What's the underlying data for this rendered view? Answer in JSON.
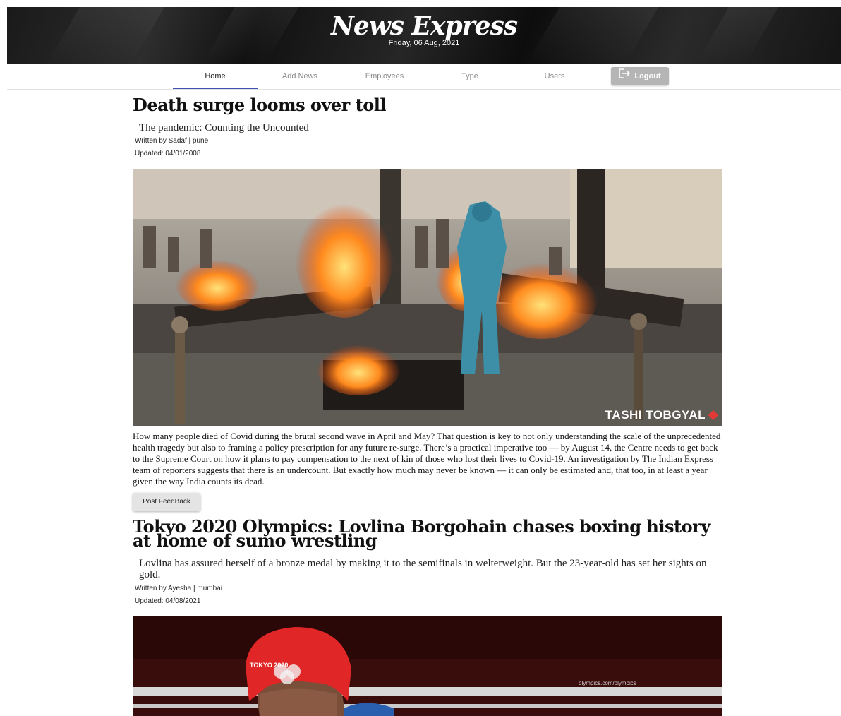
{
  "brand": {
    "title": "News Express",
    "date": "Friday, 06 Aug, 2021"
  },
  "nav": {
    "tabs": [
      {
        "label": "Home"
      },
      {
        "label": "Add News"
      },
      {
        "label": "Employees"
      },
      {
        "label": "Type"
      },
      {
        "label": "Users"
      }
    ],
    "active_tab": "Home",
    "logout_label": "Logout"
  },
  "articles": [
    {
      "headline": "Death surge looms over toll",
      "subhead": "The pandemic: Counting the Uncounted",
      "byline": "Written by Sadaf | pune",
      "updated": "Updated: 04/01/2008",
      "image_credit": "TASHI TOBGYAL",
      "body": "How many people died of Covid during the brutal second wave in April and May? That question is key to not only understanding the scale of the unprecedented health tragedy but also to framing a policy prescription for any future re-surge. There’s a practical imperative too — by August 14, the Centre needs to get back to the Supreme Court on how it plans to pay compensation to the next of kin of those who lost their lives to Covid-19. An investigation by The Indian Express team of reporters suggests that there is an undercount. But exactly how much may never be known — it can only be estimated and, that too, in at least a year given the way India counts its dead.",
      "feedback_label": "Post FeedBack"
    },
    {
      "headline": "Tokyo 2020 Olympics: Lovlina Borgohain chases boxing history at home of sumo wrestling",
      "subhead": "Lovlina has assured herself of a bronze medal by making it to the semifinals in welterweight. But the 23-year-old has set her sights on gold.",
      "byline": "Written by Ayesha | mumbai",
      "updated": "Updated: 04/08/2021",
      "image_caption": "TOKYO 2020",
      "image_url_text": "olympics.com/olympics"
    }
  ],
  "colors": {
    "active_tab_underline": "#3f51b5",
    "logout_bg": "#b5b5b5",
    "banner_bg": "#1c1c1c"
  }
}
